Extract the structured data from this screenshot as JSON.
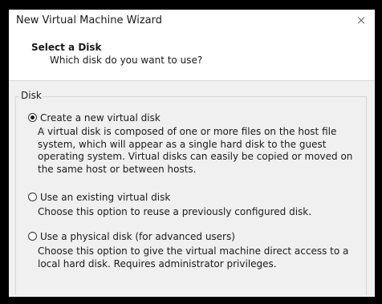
{
  "window": {
    "title": "New Virtual Machine Wizard",
    "close_glyph": "×"
  },
  "header": {
    "title": "Select a Disk",
    "subtitle": "Which disk do you want to use?"
  },
  "group": {
    "label": "Disk"
  },
  "options": [
    {
      "label": "Create a new virtual disk",
      "selected": true,
      "description": "A virtual disk is composed of one or more files on the host file system, which will appear as a single hard disk to the guest operating system. Virtual disks can easily be copied or moved on the same host or between hosts."
    },
    {
      "label": "Use an existing virtual disk",
      "selected": false,
      "description": "Choose this option to reuse a previously configured disk."
    },
    {
      "label": "Use a physical disk (for advanced users)",
      "selected": false,
      "description": "Choose this option to give the virtual machine direct access to a local hard disk. Requires administrator privileges."
    }
  ]
}
